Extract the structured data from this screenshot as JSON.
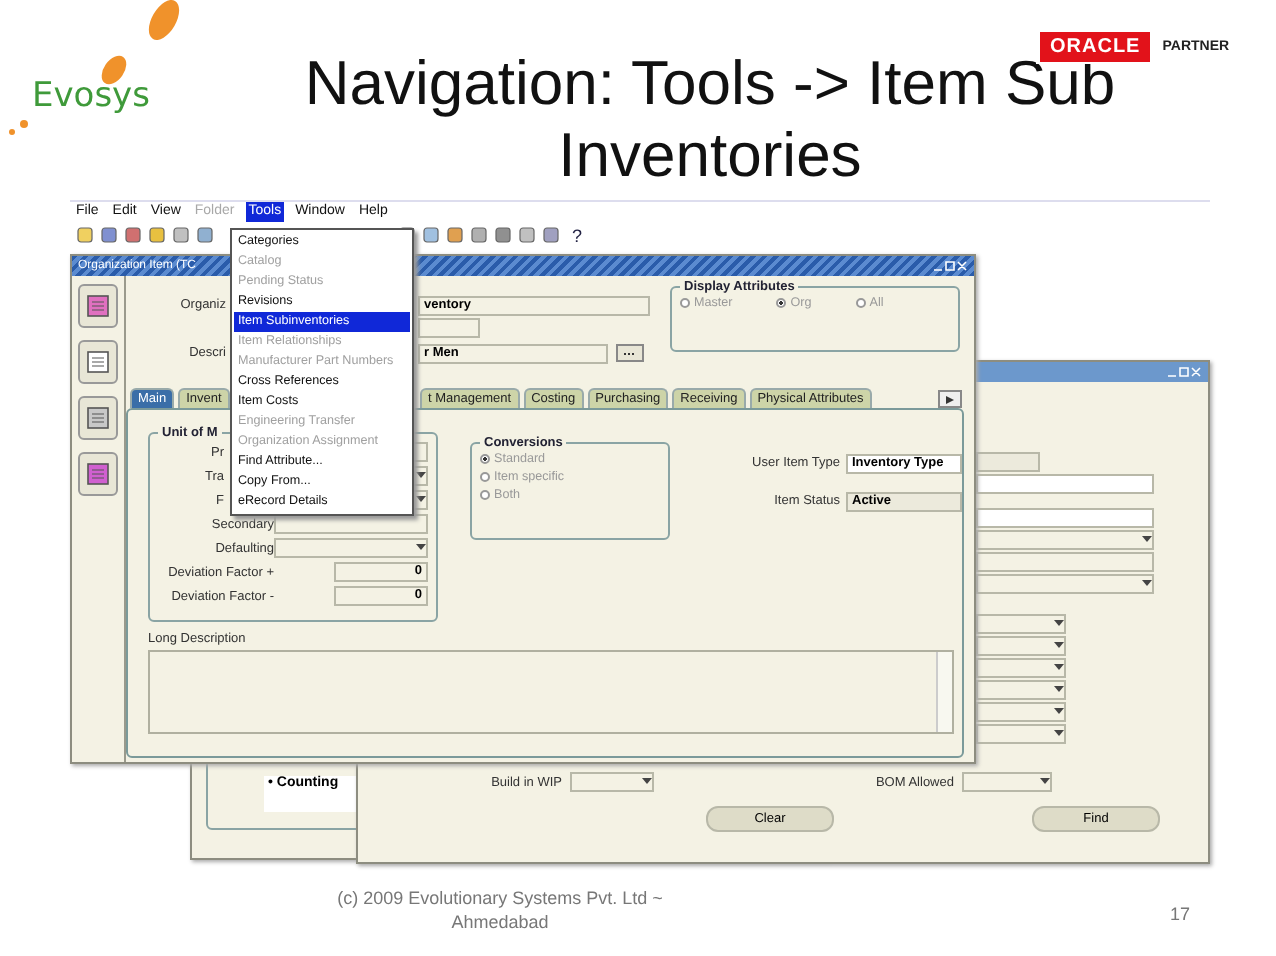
{
  "logo": {
    "text": "Evosys"
  },
  "partner": {
    "brand": "ORACLE",
    "label": "PARTNER"
  },
  "title_lines": [
    "Navigation: Tools -> Item Sub",
    "Inventories"
  ],
  "menu_bar": [
    {
      "label": "File",
      "disabled": false,
      "selected": false
    },
    {
      "label": "Edit",
      "disabled": false,
      "selected": false
    },
    {
      "label": "View",
      "disabled": false,
      "selected": false
    },
    {
      "label": "Folder",
      "disabled": true,
      "selected": false
    },
    {
      "label": "Tools",
      "disabled": false,
      "selected": true
    },
    {
      "label": "Window",
      "disabled": false,
      "selected": false
    },
    {
      "label": "Help",
      "disabled": false,
      "selected": false
    }
  ],
  "help_button": "?",
  "tools_menu": [
    {
      "label": "Categories",
      "disabled": false,
      "selected": false
    },
    {
      "label": "Catalog",
      "disabled": true,
      "selected": false
    },
    {
      "label": "Pending Status",
      "disabled": true,
      "selected": false
    },
    {
      "label": "Revisions",
      "disabled": false,
      "selected": false
    },
    {
      "label": "Item Subinventories",
      "disabled": false,
      "selected": true
    },
    {
      "label": "Item Relationships",
      "disabled": true,
      "selected": false
    },
    {
      "label": "Manufacturer Part Numbers",
      "disabled": true,
      "selected": false
    },
    {
      "label": "Cross References",
      "disabled": false,
      "selected": false
    },
    {
      "label": "Item Costs",
      "disabled": false,
      "selected": false
    },
    {
      "label": "Engineering Transfer",
      "disabled": true,
      "selected": false
    },
    {
      "label": "Organization Assignment",
      "disabled": true,
      "selected": false
    },
    {
      "label": "Find Attribute...",
      "disabled": false,
      "selected": false
    },
    {
      "label": "Copy From...",
      "disabled": false,
      "selected": false
    },
    {
      "label": "eRecord Details",
      "disabled": false,
      "selected": false
    }
  ],
  "front_window": {
    "title": "Organization Item (TC",
    "organization": {
      "label": "Organiz",
      "value": "ventory"
    },
    "description": {
      "label": "Descri",
      "value": "r Men"
    },
    "display_attributes": {
      "title": "Display Attributes",
      "options": [
        {
          "label": "Master",
          "selected": false
        },
        {
          "label": "Org",
          "selected": true
        },
        {
          "label": "All",
          "selected": false
        }
      ]
    },
    "tabs_left": [
      {
        "label": "Main",
        "selected": true
      },
      {
        "label": "Invent",
        "selected": false
      }
    ],
    "tabs_right": [
      {
        "label": "t Management",
        "selected": false
      },
      {
        "label": "Costing",
        "selected": false
      },
      {
        "label": "Purchasing",
        "selected": false
      },
      {
        "label": "Receiving",
        "selected": false
      },
      {
        "label": "Physical Attributes",
        "selected": false
      }
    ],
    "unit_group": {
      "title": "Unit of M",
      "rows": [
        {
          "label": "Pr",
          "kind": "field",
          "clipped": true
        },
        {
          "label": "Tra",
          "kind": "select",
          "clipped": true
        },
        {
          "label": "F",
          "kind": "select",
          "clipped": true
        },
        {
          "label": "Secondary",
          "kind": "field",
          "clipped": false
        },
        {
          "label": "Defaulting",
          "kind": "select",
          "clipped": false
        },
        {
          "label": "Deviation Factor +",
          "kind": "number",
          "clipped": false,
          "value": "0"
        },
        {
          "label": "Deviation Factor -",
          "kind": "number",
          "clipped": false,
          "value": "0"
        }
      ]
    },
    "conversions": {
      "title": "Conversions",
      "options": [
        {
          "label": "Standard",
          "selected": true
        },
        {
          "label": "Item specific",
          "selected": false
        },
        {
          "label": "Both",
          "selected": false
        }
      ]
    },
    "user_item_type": {
      "label": "User Item Type",
      "value": "Inventory Type"
    },
    "item_status": {
      "label": "Item Status",
      "value": "Active"
    },
    "long_description": {
      "label": "Long Description"
    }
  },
  "middle_window": {
    "list": [
      "• Counting"
    ]
  },
  "back_window": {
    "build_in_wip": {
      "label": "Build in WIP"
    },
    "bom_allowed": {
      "label": "BOM Allowed"
    },
    "buttons": [
      "Clear",
      "Find"
    ]
  },
  "footer_lines": [
    "(c) 2009 Evolutionary Systems Pvt. Ltd ~",
    "Ahmedabad"
  ],
  "page_number": "17"
}
